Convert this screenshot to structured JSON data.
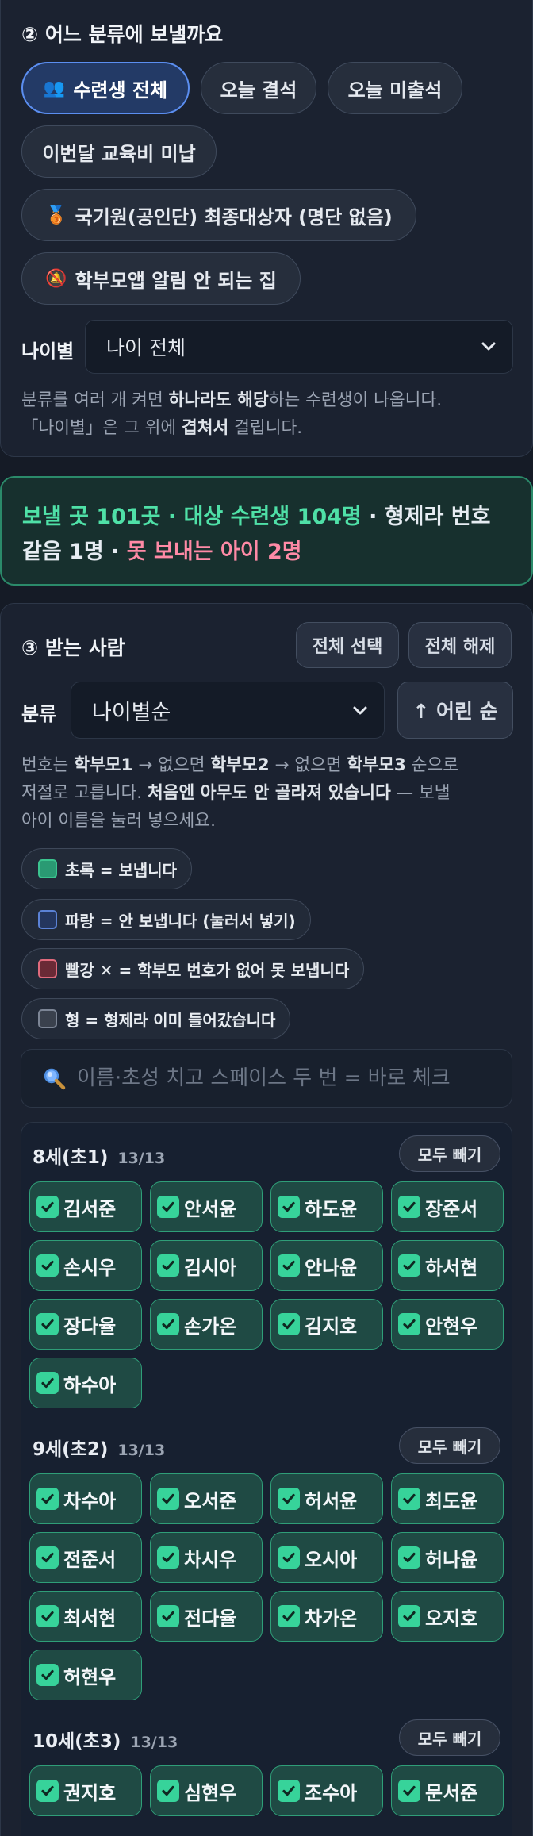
{
  "filter": {
    "title": "② 어느 분류에 보낼까요",
    "categories": [
      {
        "label": "수련생 전체",
        "emoji": "👥",
        "active": true
      },
      {
        "label": "오늘 결석",
        "emoji": "",
        "active": false
      },
      {
        "label": "오늘 미출석",
        "emoji": "",
        "active": false
      },
      {
        "label": "이번달 교육비 미납",
        "emoji": "",
        "active": false
      },
      {
        "label": "국기원(공인단) 최종대상자 (명단 없음)",
        "emoji": "🥉",
        "active": false
      },
      {
        "label": "학부모앱 알림 안 되는 집",
        "emoji": "🔕",
        "active": false
      }
    ],
    "age_label": "나이별",
    "age_select": "나이 전체",
    "help_1a": "분류를 여러 개 켜면 ",
    "help_1b": "하나라도 해당",
    "help_1c": "하는 수련생이 나옵니다.",
    "help_2a": "「나이별」은 그 위에 ",
    "help_2b": "겹쳐서",
    "help_2c": " 걸립니다."
  },
  "summary": {
    "part1": "보낼 곳 101곳 · 대상 수련생 104명",
    "part2": " · 형제라 번호 같음 1명 · ",
    "part3": "못 보내는 아이 2명"
  },
  "recipients": {
    "title": "③ 받는 사람",
    "select_all": "전체 선택",
    "deselect_all": "전체 해제",
    "sort_label": "분류",
    "sort_select": "나이별순",
    "order_button": "↑ 어린 순",
    "help_1a": "번호는 ",
    "help_1b": "학부모1",
    "help_1c": " → 없으면 ",
    "help_1d": "학부모2",
    "help_1e": " → 없으면 ",
    "help_1f": "학부모3",
    "help_1g": " 순으로",
    "help_2a": "저절로 고릅니다. ",
    "help_2b": "처음엔 아무도 안 골라져 있습니다",
    "help_2c": " — 보낼",
    "help_3": "아이 이름을 눌러 넣으세요.",
    "legend": [
      {
        "label": "초록 = 보냅니다",
        "color": "#2a9a73",
        "border": "#3bc48f"
      },
      {
        "label": "파랑 = 안 보냅니다 (눌러서 넣기)",
        "color": "#24365e",
        "border": "#5b82d6"
      },
      {
        "label": "빨강 ✕ = 학부모 번호가 없어 못 보냅니다",
        "color": "#6a2a36",
        "border": "#e06a7c"
      },
      {
        "label": "형 = 형제라 이미 들어갔습니다",
        "color": "#3a414d",
        "border": "#7c8595"
      }
    ],
    "search_placeholder": "이름·초성 치고 스페이스 두 번 = 바로 체크",
    "groups": [
      {
        "title": "8세(초1)",
        "count": "13/13",
        "button": "모두 빼기",
        "names": [
          "김서준",
          "안서윤",
          "하도윤",
          "장준서",
          "손시우",
          "김시아",
          "안나윤",
          "하서현",
          "장다율",
          "손가온",
          "김지호",
          "안현우",
          "하수아"
        ]
      },
      {
        "title": "9세(초2)",
        "count": "13/13",
        "button": "모두 빼기",
        "names": [
          "차수아",
          "오서준",
          "허서윤",
          "최도윤",
          "전준서",
          "차시우",
          "오시아",
          "허나윤",
          "최서현",
          "전다율",
          "차가온",
          "오지호",
          "허현우"
        ]
      },
      {
        "title": "10세(초3)",
        "count": "13/13",
        "button": "모두 빼기",
        "names": [
          "권지호",
          "심현우",
          "조수아",
          "문서준"
        ]
      }
    ]
  }
}
